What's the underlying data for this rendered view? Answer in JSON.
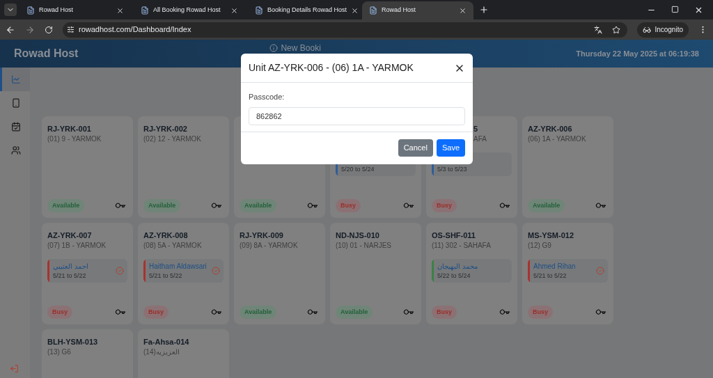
{
  "browser": {
    "tabs": [
      {
        "title": "Rowad Host",
        "selected": false
      },
      {
        "title": "All Booking Rowad Host",
        "selected": false
      },
      {
        "title": "Booking Details Rowad Host",
        "selected": false
      },
      {
        "title": "Rowad Host",
        "selected": true
      }
    ],
    "url": "rowadhost.com/Dashboard/Index",
    "profile": "Incognito"
  },
  "header": {
    "title": "Rowad Host",
    "new_booking": "New Booki",
    "datetime": "Thursday 22 May 2025 at 06:19:38"
  },
  "sidebar": {
    "items": [
      {
        "kind": "chart",
        "selected": true
      },
      {
        "kind": "phone",
        "selected": false
      },
      {
        "kind": "calendar",
        "selected": false
      },
      {
        "kind": "users",
        "selected": false
      }
    ]
  },
  "units": [
    {
      "title": "RJ-YRK-001",
      "subtitle": "(01) 9 - YARMOK",
      "status": {
        "kind": "available",
        "label": "Available"
      }
    },
    {
      "title": "RJ-YRK-002",
      "subtitle": "(02) 12 - YARMOK",
      "status": {
        "kind": "available",
        "label": "Available"
      }
    },
    {
      "status": {
        "kind": "available",
        "label": "Available"
      }
    },
    {
      "booking": {
        "dates": "5/20 to 5/24",
        "color": "#2e5d99",
        "confirmed": false
      },
      "status": {
        "kind": "busy",
        "label": "Busy"
      }
    },
    {
      "title": "5",
      "subtitle": "AFA",
      "covered": true,
      "booking": {
        "dates": "5/3 to 5/23",
        "color": "#2e5d99",
        "confirmed": false
      },
      "status": {
        "kind": "busy",
        "label": "Busy"
      }
    },
    {
      "title": "AZ-YRK-006",
      "subtitle": "(06) 1A - YARMOK",
      "status": {
        "kind": "available",
        "label": "Available"
      }
    },
    {
      "title": "AZ-YRK-007",
      "subtitle": "(07) 1B - YARMOK",
      "booking": {
        "name": "احمد العتيبي",
        "dates": "5/21 to 5/22",
        "color": "#a8322d",
        "confirmed": true
      },
      "status": {
        "kind": "busy",
        "label": "Busy"
      }
    },
    {
      "title": "AZ-YRK-008",
      "subtitle": "(08) 5A - YARMOK",
      "booking": {
        "name": "Haitham Aldawsari",
        "dates": "5/21 to 5/22",
        "color": "#a8322d",
        "confirmed": true
      },
      "status": {
        "kind": "busy",
        "label": "Busy"
      }
    },
    {
      "title": "RJ-YRK-009",
      "subtitle": "(09) 8A - YARMOK",
      "status": {
        "kind": "available",
        "label": "Available"
      }
    },
    {
      "title": "ND-NJS-010",
      "subtitle": "(10) 01 - NARJES",
      "status": {
        "kind": "available",
        "label": "Available"
      }
    },
    {
      "title": "OS-SHF-011",
      "subtitle": "(11) 302 - SAHAFA",
      "booking": {
        "name": "محمد البهيجان",
        "dates": "5/22 to 5/24",
        "color": "#3a8245",
        "confirmed": false
      },
      "status": {
        "kind": "busy",
        "label": "Busy"
      }
    },
    {
      "title": "MS-YSM-012",
      "subtitle": "(12) G9",
      "booking": {
        "name": "Ahmed Rihan",
        "dates": "5/21 to 5/22",
        "color": "#a8322d",
        "confirmed": true
      },
      "status": {
        "kind": "busy",
        "label": "Busy"
      }
    },
    {
      "title": "BLH-YSM-013",
      "subtitle": "(13) G6"
    },
    {
      "title": "Fa-Ahsa-014",
      "subtitle": "(14)العزيزيه"
    }
  ],
  "modal": {
    "title": "Unit AZ-YRK-006 - (06) 1A - YARMOK",
    "label": "Passcode:",
    "value": "862862",
    "buttons": [
      {
        "kind": "secondary",
        "label": "Cancel"
      },
      {
        "kind": "primary",
        "label": "Save"
      }
    ]
  }
}
